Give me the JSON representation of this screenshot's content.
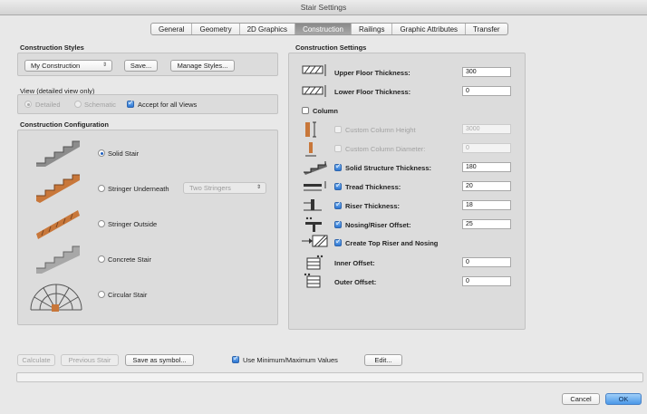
{
  "window": {
    "title": "Stair Settings"
  },
  "tabs": [
    {
      "label": "General",
      "active": false
    },
    {
      "label": "Geometry",
      "active": false
    },
    {
      "label": "2D Graphics",
      "active": false
    },
    {
      "label": "Construction",
      "active": true
    },
    {
      "label": "Railings",
      "active": false
    },
    {
      "label": "Graphic Attributes",
      "active": false
    },
    {
      "label": "Transfer",
      "active": false
    }
  ],
  "construction_styles": {
    "title": "Construction Styles",
    "selected": "My Construction",
    "save_label": "Save...",
    "manage_label": "Manage Styles..."
  },
  "view": {
    "title": "View (detailed view only)",
    "detailed": "Detailed",
    "schematic": "Schematic",
    "accept_all": "Accept for all Views",
    "accept_all_checked": true
  },
  "configuration": {
    "title": "Construction Configuration",
    "options": [
      {
        "label": "Solid Stair",
        "selected": true
      },
      {
        "label": "Stringer Underneath",
        "selected": false
      },
      {
        "label": "Stringer Outside",
        "selected": false
      },
      {
        "label": "Concrete Stair",
        "selected": false
      },
      {
        "label": "Circular Stair",
        "selected": false
      }
    ],
    "stringer_popup": "Two Stringers"
  },
  "settings": {
    "title": "Construction Settings",
    "upper_floor": {
      "label": "Upper Floor Thickness:",
      "value": "300"
    },
    "lower_floor": {
      "label": "Lower Floor Thickness:",
      "value": "0"
    },
    "column": {
      "label": "Column",
      "checked": false
    },
    "custom_column_height": {
      "label": "Custom Column Height",
      "value": "3000",
      "checked": false
    },
    "custom_column_diameter": {
      "label": "Custom Column Diameter:",
      "value": "0",
      "checked": false
    },
    "solid_structure": {
      "label": "Solid Structure Thickness:",
      "value": "180",
      "checked": true
    },
    "tread": {
      "label": "Tread Thickness:",
      "value": "20",
      "checked": true
    },
    "riser": {
      "label": "Riser Thickness:",
      "value": "18",
      "checked": true
    },
    "nosing": {
      "label": "Nosing/Riser Offset:",
      "value": "25",
      "checked": true
    },
    "top_riser": {
      "label": "Create Top Riser and Nosing",
      "checked": true
    },
    "inner_offset": {
      "label": "Inner Offset:",
      "value": "0"
    },
    "outer_offset": {
      "label": "Outer Offset:",
      "value": "0"
    }
  },
  "bottom": {
    "calculate": "Calculate",
    "previous": "Previous Stair",
    "save_symbol": "Save as symbol...",
    "use_minmax": "Use Minimum/Maximum Values",
    "use_minmax_checked": true,
    "edit": "Edit...",
    "cancel": "Cancel",
    "ok": "OK"
  },
  "colors": {
    "accent": "#2b76d4",
    "wood": "#c8773a",
    "tab_active": "#9a9a9a"
  }
}
